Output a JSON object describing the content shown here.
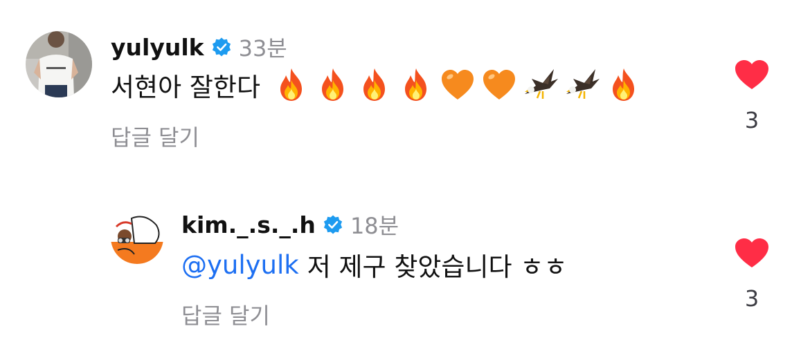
{
  "comments": [
    {
      "username": "yulyulk",
      "time": "33분",
      "text": "서현아 잘한다",
      "emoji": [
        "fire",
        "fire",
        "fire",
        "fire",
        "orange-heart",
        "orange-heart",
        "eagle",
        "eagle",
        "fire"
      ],
      "reply_label": "답글 달기",
      "likes": "3"
    },
    {
      "username": "kim._.s._.h",
      "time": "18분",
      "mention": "@yulyulk",
      "text": "저 제구 찾았습니다 ㅎㅎ",
      "reply_label": "답글 달기",
      "likes": "3"
    }
  ],
  "icons": {
    "verified": "verified-badge-icon",
    "like": "heart-icon"
  },
  "colors": {
    "verified_blue": "#1d9bf0",
    "heart_red": "#ff2d46",
    "mention_blue": "#1d6ff2",
    "secondary_gray": "#8e8e93"
  }
}
